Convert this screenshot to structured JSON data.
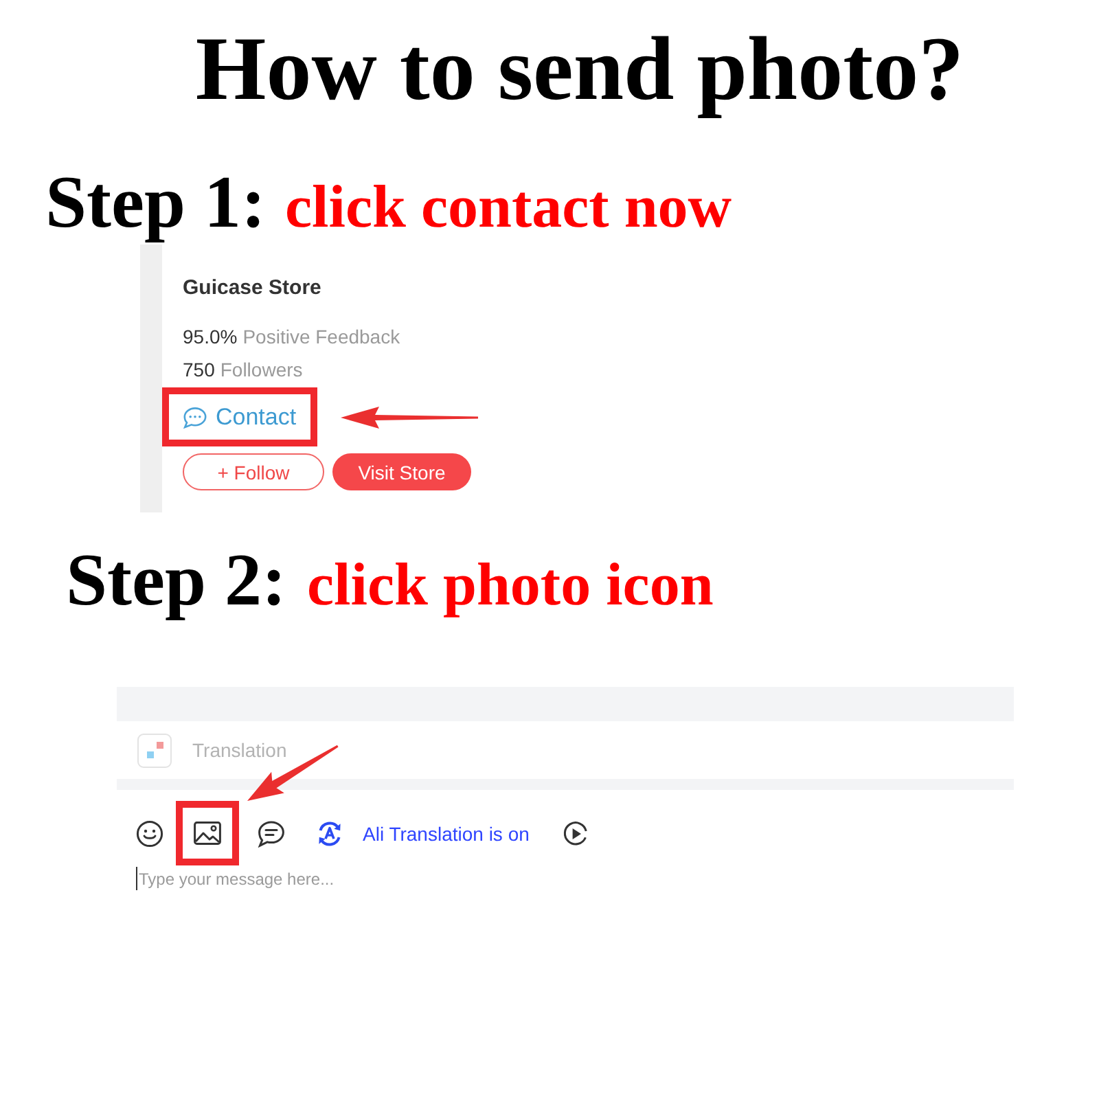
{
  "title": "How to send photo?",
  "step_1": {
    "label": "Step 1:",
    "instruction": "click contact now",
    "store_card": {
      "name": "Guicase Store",
      "stats": [
        {
          "value": "95.0%",
          "label": "Positive Feedback"
        },
        {
          "value": "750",
          "label": "Followers"
        }
      ],
      "contact": {
        "label": "Contact",
        "highlighted": true
      },
      "buttons": [
        {
          "label": "+ Follow",
          "kind": "outline"
        },
        {
          "label": "Visit Store",
          "kind": "filled"
        }
      ]
    }
  },
  "step_2": {
    "label": "Step 2:",
    "instruction": "click photo icon",
    "chat_panel": {
      "translation_bar": {
        "label": "Translation"
      },
      "toolbar": {
        "photo_button": {
          "highlighted": true
        },
        "translation_status": "Ali Translation is on"
      },
      "message_field": {
        "placeholder": "Type your message here..."
      }
    }
  }
}
